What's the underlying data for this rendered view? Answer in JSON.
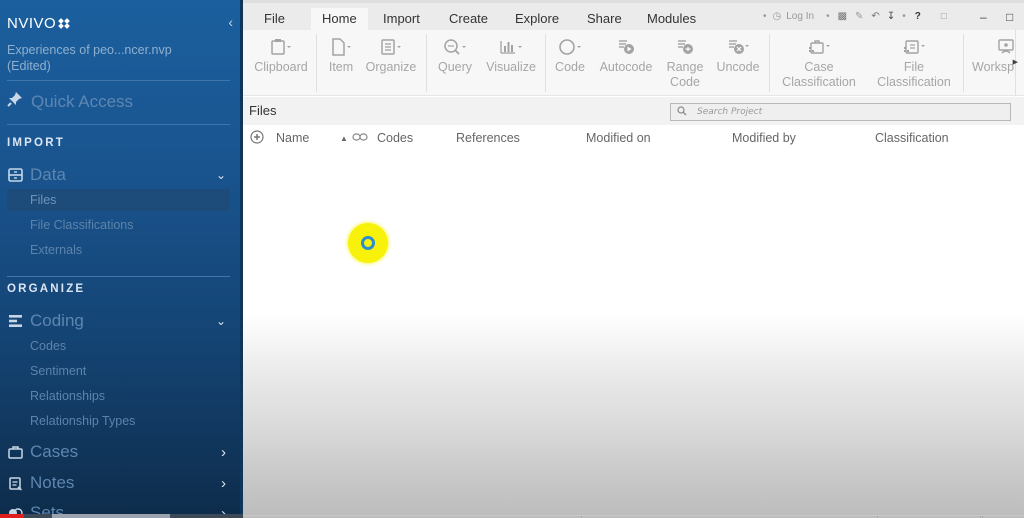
{
  "app": {
    "logo": "NVIVO",
    "project_name": "Experiences of peo...ncer.nvp",
    "project_status": "(Edited)"
  },
  "sidebar": {
    "quick_access": "Quick Access",
    "sections": [
      {
        "title": "IMPORT",
        "group": {
          "label": "Data",
          "icon": "data-drawer-icon",
          "expanded": true
        },
        "items": [
          {
            "label": "Files",
            "active": true
          },
          {
            "label": "File Classifications",
            "active": false
          },
          {
            "label": "Externals",
            "active": false
          }
        ]
      },
      {
        "title": "ORGANIZE",
        "group": {
          "label": "Coding",
          "icon": "coding-lines-icon",
          "expanded": true
        },
        "items": [
          {
            "label": "Codes",
            "active": false
          },
          {
            "label": "Sentiment",
            "active": false
          },
          {
            "label": "Relationships",
            "active": false
          },
          {
            "label": "Relationship Types",
            "active": false
          }
        ]
      }
    ],
    "collapsed_groups": [
      {
        "label": "Cases",
        "icon": "briefcase-icon"
      },
      {
        "label": "Notes",
        "icon": "notes-icon"
      },
      {
        "label": "Sets",
        "icon": "sets-icon"
      }
    ]
  },
  "tabs": [
    {
      "label": "File",
      "active": false
    },
    {
      "label": "Home",
      "active": true
    },
    {
      "label": "Import",
      "active": false
    },
    {
      "label": "Create",
      "active": false
    },
    {
      "label": "Explore",
      "active": false
    },
    {
      "label": "Share",
      "active": false
    },
    {
      "label": "Modules",
      "active": false
    }
  ],
  "quick_toolbar": {
    "login_label": "Log In",
    "help_label": "?"
  },
  "ribbon": {
    "buttons": [
      {
        "label": "Clipboard",
        "icon": "clipboard-icon"
      },
      {
        "label": "Item",
        "icon": "new-item-icon"
      },
      {
        "label": "Organize",
        "icon": "organize-icon"
      },
      {
        "label": "Query",
        "icon": "query-icon"
      },
      {
        "label": "Visualize",
        "icon": "visualize-icon"
      },
      {
        "label": "Code",
        "icon": "code-icon"
      },
      {
        "label": "Autocode",
        "icon": "autocode-icon"
      },
      {
        "label": "Range Code",
        "line1": "Range",
        "line2": "Code",
        "icon": "range-code-icon"
      },
      {
        "label": "Uncode",
        "icon": "uncode-icon"
      },
      {
        "label": "Case Classification",
        "line1": "Case",
        "line2": "Classification",
        "icon": "case-classification-icon"
      },
      {
        "label": "File Classification",
        "line1": "File",
        "line2": "Classification",
        "icon": "file-classification-icon"
      },
      {
        "label": "Worksp",
        "icon": "workspace-icon"
      }
    ]
  },
  "files_panel": {
    "title": "Files",
    "search_placeholder": "Search Project",
    "columns": [
      "Name",
      "Codes",
      "References",
      "Modified on",
      "Modified by",
      "Classification"
    ],
    "rows": []
  },
  "colors": {
    "sidebar_top": "#1b5f9e",
    "sidebar_bottom": "#0e2c4b",
    "cursor_highlight": "#f8f20b",
    "cursor_ring": "#2a8ed0",
    "progress_red": "#e01e1e"
  }
}
